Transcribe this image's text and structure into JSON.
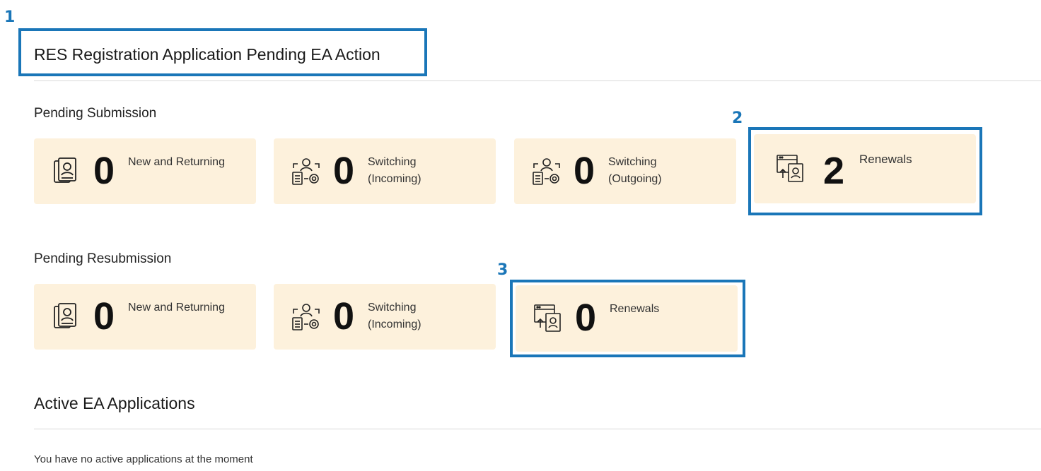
{
  "callouts": [
    "1",
    "2",
    "3"
  ],
  "header": {
    "title": "RES Registration Application Pending EA Action"
  },
  "pending_submission": {
    "label": "Pending Submission",
    "cards": [
      {
        "count": "0",
        "label": "New and Returning",
        "icon": "document-person-icon"
      },
      {
        "count": "0",
        "label": "Switching\n(Incoming)",
        "icon": "switching-icon"
      },
      {
        "count": "0",
        "label": "Switching\n(Outgoing)",
        "icon": "switching-icon"
      },
      {
        "count": "2",
        "label": "Renewals",
        "icon": "renewal-icon"
      }
    ]
  },
  "pending_resubmission": {
    "label": "Pending Resubmission",
    "cards": [
      {
        "count": "0",
        "label": "New and Returning",
        "icon": "document-person-icon"
      },
      {
        "count": "0",
        "label": "Switching\n(Incoming)",
        "icon": "switching-icon"
      },
      {
        "count": "0",
        "label": "Renewals",
        "icon": "renewal-icon"
      }
    ]
  },
  "active": {
    "title": "Active EA Applications",
    "empty_message": "You have no active applications at the moment"
  },
  "colors": {
    "callout": "#1a76b8",
    "card_bg": "#fdf1dc"
  }
}
